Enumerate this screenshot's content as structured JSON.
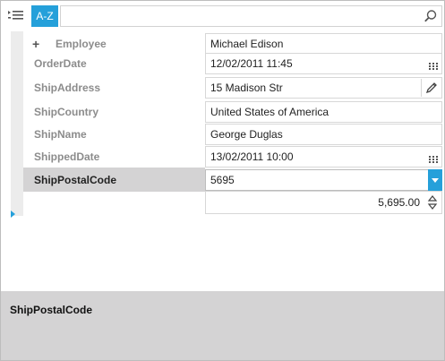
{
  "toolbar": {
    "categorize_icon": "categorized-list-icon",
    "sort_label": "A-Z",
    "search": {
      "value": "",
      "placeholder": ""
    },
    "search_icon": "search-icon"
  },
  "properties": [
    {
      "name": "Employee",
      "value": "Michael Edison",
      "expandable": true,
      "expander_symbol": "+"
    },
    {
      "name": "OrderDate",
      "value": "12/02/2011 11:45",
      "editor_icon": "calendar-picker-icon"
    },
    {
      "name": "ShipAddress",
      "value": "15 Madison Str",
      "editor_icon": "pencil-icon"
    },
    {
      "name": "ShipCountry",
      "value": "United States of America"
    },
    {
      "name": "ShipName",
      "value": "George Duglas"
    },
    {
      "name": "ShippedDate",
      "value": "13/02/2011 10:00",
      "editor_icon": "calendar-picker-icon"
    },
    {
      "name": "ShipPostalCode",
      "value": "5695",
      "selected": true,
      "editor_icon": "chevron-down-icon"
    }
  ],
  "numeric_editor": {
    "value": "5,695.00",
    "icon": "spin-updown-icon"
  },
  "description": {
    "title": "ShipPostalCode"
  },
  "colors": {
    "accent": "#25a0da",
    "selected_row": "#d4d3d4",
    "description_bg": "#d4d3d4"
  }
}
